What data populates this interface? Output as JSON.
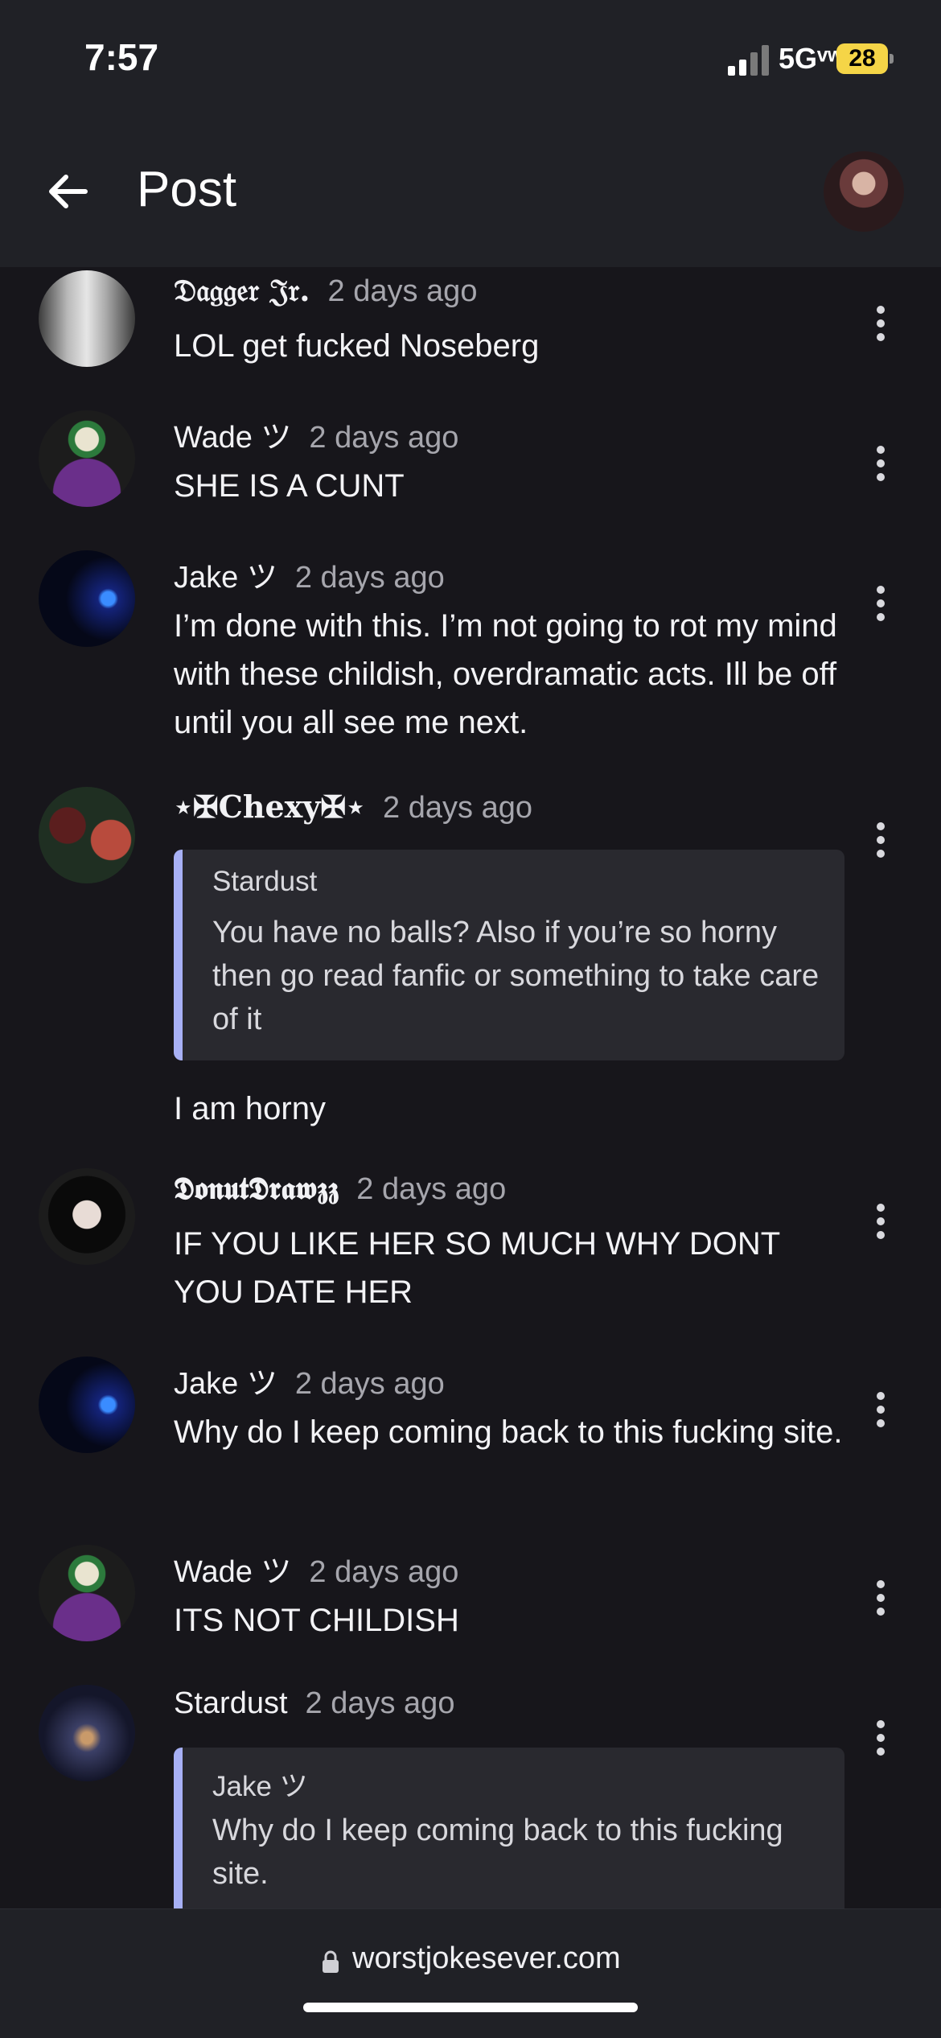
{
  "status": {
    "time": "7:57",
    "network": "5Gᵛʷ",
    "battery": "28"
  },
  "header": {
    "title": "Post"
  },
  "comments": [
    {
      "name": "𝔇𝔞𝔤𝔤𝔢𝔯 𝔍𝔯.",
      "time": "2 days ago",
      "text": "LOL get fucked Noseberg"
    },
    {
      "name": "Wade ツ",
      "time": "2 days ago",
      "text": "SHE IS A CUNT"
    },
    {
      "name": "Jake ツ",
      "time": "2 days ago",
      "text": "I’m done with this. I’m not going to rot my mind with these childish, overdramatic acts. Ill be off until you all see me next."
    },
    {
      "name": "⋆✠𝐂𝐡𝐞𝐱𝐲✠⋆",
      "time": "2 days ago",
      "quote_name": "Stardust",
      "quote_text": "You have no balls? Also if you’re so horny then go read fanfic or something to take care of it",
      "text": "I am horny"
    },
    {
      "name": "𝕯𝖔𝖓𝖚𝖙𝕯𝖗𝖆𝖜𝖟𝖟",
      "time": "2 days ago",
      "text": "IF YOU LIKE HER SO MUCH WHY DONT YOU DATE HER"
    },
    {
      "name": "Jake ツ",
      "time": "2 days ago",
      "text": "Why do I keep coming back to this fucking site."
    },
    {
      "name": "Wade ツ",
      "time": "2 days ago",
      "text": "ITS NOT CHILDISH"
    },
    {
      "name": "Stardust",
      "time": "2 days ago",
      "quote_name": "Jake ツ",
      "quote_text": "Why do I keep coming back to this fucking site."
    }
  ],
  "footer": {
    "url": "worstjokesever.com"
  },
  "icons": {
    "back": "back-arrow-icon",
    "more": "more-vertical-icon",
    "lock": "lock-icon"
  }
}
